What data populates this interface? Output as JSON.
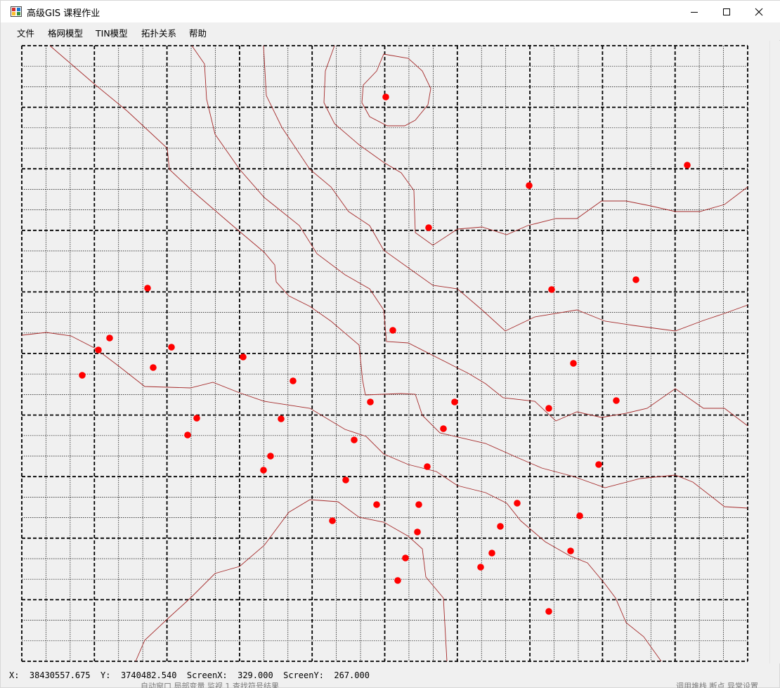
{
  "window": {
    "title": "高级GIS 课程作业",
    "minimize_label": "—",
    "maximize_label": "☐",
    "close_label": "✕"
  },
  "menu": {
    "items": [
      {
        "label": "文件"
      },
      {
        "label": "格网模型"
      },
      {
        "label": "TIN模型"
      },
      {
        "label": "拓扑关系"
      },
      {
        "label": "帮助"
      }
    ]
  },
  "status": {
    "text": "X:  38430557.675  Y:  3740482.540  ScreenX:  329.000  ScreenY:  267.000"
  },
  "behind_window": {
    "left_text": "自动窗口  局部变量  监视 1  查找符号结果",
    "right_text": "调用堆栈  断点  异常设置"
  },
  "colors": {
    "point": "#ff0000",
    "contour": "#a52a2a",
    "grid": "#000000",
    "background": "#f0f0f0"
  },
  "icons": {
    "app": "app-grid-icon",
    "minimize": "minimize-icon",
    "maximize": "maximize-icon",
    "close": "close-icon"
  }
}
